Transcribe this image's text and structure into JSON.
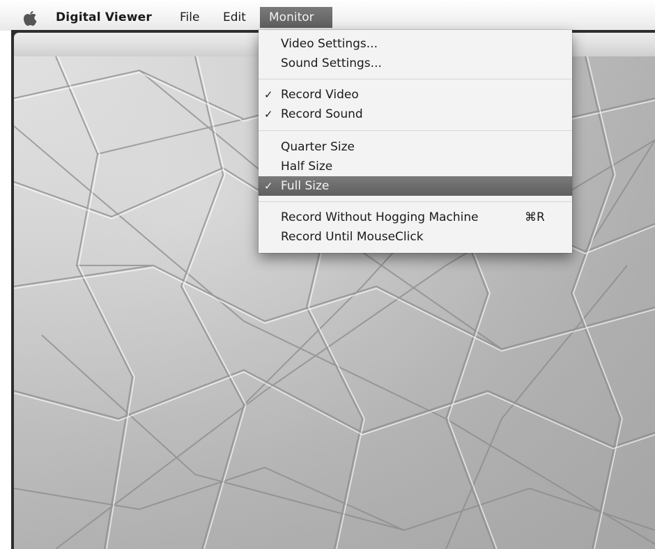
{
  "menubar": {
    "apple_icon": "apple-logo-icon",
    "app_name": "Digital Viewer",
    "file_label": "File",
    "edit_label": "Edit",
    "monitor_label": "Monitor"
  },
  "monitor_menu": {
    "video_settings": "Video Settings...",
    "sound_settings": "Sound Settings...",
    "record_video": "Record Video",
    "record_sound": "Record Sound",
    "quarter_size": "Quarter Size",
    "half_size": "Half Size",
    "full_size": "Full Size",
    "record_without_hogging": "Record Without Hogging Machine",
    "record_without_hogging_shortcut": "⌘R",
    "record_until_mouseclick": "Record Until MouseClick",
    "check_glyph": "✓",
    "checked": [
      "Record Video",
      "Record Sound",
      "Full Size"
    ],
    "highlighted": "Full Size"
  },
  "colors": {
    "menubar_bg": "#f4f4f4",
    "highlight": "#6a6a6a",
    "menu_bg": "#f3f3f3",
    "window_frame": "#2e2e2e"
  }
}
